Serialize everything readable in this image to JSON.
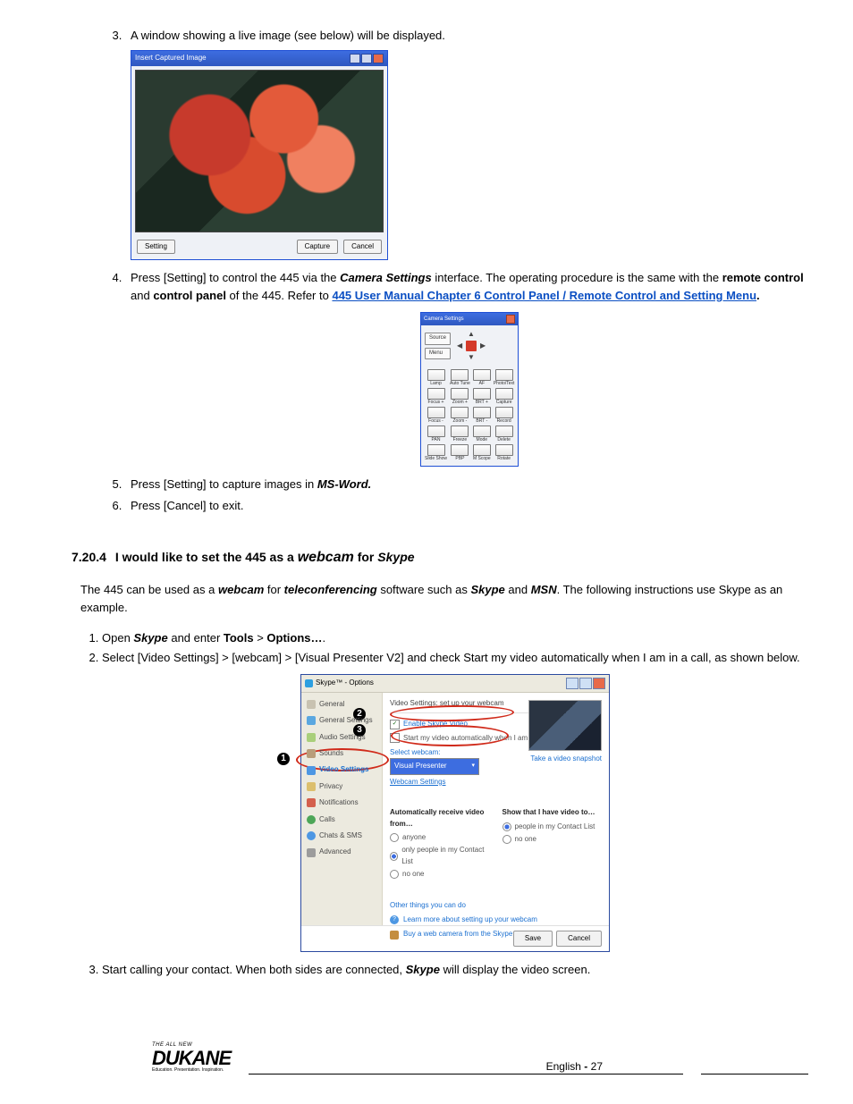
{
  "steps_a": {
    "s3": "A window showing a live image (see below) will be displayed.",
    "s4_pre": "Press [Setting] to control the 445 via the ",
    "s4_cs": "Camera Settings",
    "s4_mid": " interface. The operating procedure is the same with the ",
    "s4_rc": "remote control",
    "s4_and": " and ",
    "s4_cp": "control panel",
    "s4_after": " of the 445. Refer to ",
    "s4_link": "445 User Manual Chapter 6 Control Panel / Remote Control and Setting Menu",
    "s4_dot": ".",
    "s5_pre": "Press [Setting] to capture images in ",
    "s5_em": "MS-Word.",
    "s6": "Press [Cancel] to exit."
  },
  "capwin": {
    "title": "Insert Captured Image",
    "setting": "Setting",
    "capture": "Capture",
    "cancel": "Cancel"
  },
  "camset": {
    "title": "Camera Settings",
    "source": "Source",
    "menu": "Menu",
    "labels": [
      "Lamp",
      "Auto Tune",
      "AF",
      "Photo/Text",
      "Focus +",
      "Zoom +",
      "BRT +",
      "Capture",
      "Focus -",
      "Zoom -",
      "BRT -",
      "Record",
      "PAN",
      "Freeze",
      "Mode",
      "Delete",
      "Slide Show",
      "PBP",
      "M Scope",
      "Rotate"
    ]
  },
  "section": {
    "num": "7.20.4",
    "pre": "I would like to set the 445 as a ",
    "webcam": "webcam",
    "for": " for ",
    "skype": "Skype"
  },
  "para": {
    "pre": "The 445 can be used as a ",
    "webcam": "webcam",
    "for": " for ",
    "tele": "teleconferencing",
    "mid": " software such as ",
    "sky": "Skype",
    "and": " and ",
    "msn": "MSN",
    "tail": ". The following instructions use Skype as an example."
  },
  "steps_b": {
    "s1_pre": "Open ",
    "s1_sky": "Skype",
    "s1_mid": " and enter ",
    "s1_tools": "Tools",
    "s1_gt": " > ",
    "s1_opts": "Options…",
    "s1_dot": ".",
    "s2": "Select [Video Settings] > [webcam] > [Visual Presenter V2] and check Start my video automatically when I am in a call, as shown below.",
    "s3_pre": "Start calling your contact. When both sides are connected, ",
    "s3_sky": "Skype",
    "s3_tail": " will display the video screen."
  },
  "skype": {
    "title": "Skype™ - Options",
    "side": [
      "General",
      "General Settings",
      "Audio Settings",
      "Sounds",
      "Video Settings",
      "Privacy",
      "Notifications",
      "Calls",
      "Chats & SMS",
      "Advanced"
    ],
    "vs_head": "Video Settings: set up your webcam",
    "chk_enable": "Enable Skype Video",
    "chk_auto": "Start my video automatically when I am in a call",
    "sel_label": "Select webcam:",
    "dropdown": "Visual Presenter",
    "webset": "Webcam Settings",
    "snapshot": "Take a video snapshot",
    "col1_head": "Automatically receive video from…",
    "col2_head": "Show that I have video to…",
    "opts1": [
      "anyone",
      "only people in my Contact List",
      "no one"
    ],
    "opts2": [
      "people in my Contact List",
      "no one"
    ],
    "other_head": "Other things you can do",
    "link_learn": "Learn more about setting up your webcam",
    "link_buy": "Buy a web camera from the Skype Shop",
    "save": "Save",
    "cancel": "Cancel",
    "badges": [
      "1",
      "2",
      "3"
    ]
  },
  "footer": {
    "tag": "THE ALL NEW",
    "brand": "DUKANE",
    "sub": "Education. Presentation. Inspiration.",
    "page_pre": "English ",
    "dash": "- ",
    "num": "27"
  }
}
